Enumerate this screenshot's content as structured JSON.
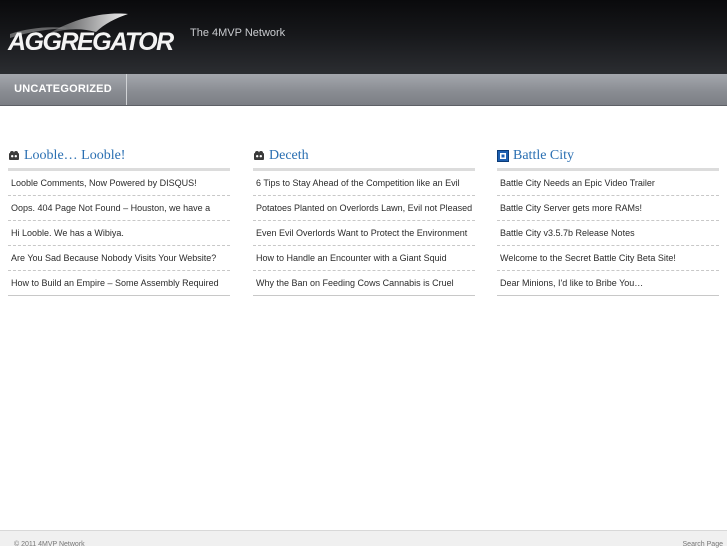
{
  "header": {
    "logo_text": "AGGREGATOR",
    "tagline": "The 4MVP Network"
  },
  "nav": {
    "items": [
      {
        "label": "UNCATEGORIZED"
      }
    ]
  },
  "columns": [
    {
      "title": "Looble… Looble!",
      "icon": "looble-favicon-icon",
      "posts": [
        "Looble Comments, Now Powered by DISQUS!",
        "Oops. 404 Page Not Found – Houston, we have a",
        "Hi Looble. We has a Wibiya.",
        "Are You Sad Because Nobody Visits Your Website?",
        "How to Build an Empire – Some Assembly Required"
      ]
    },
    {
      "title": "Deceth",
      "icon": "deceth-favicon-icon",
      "posts": [
        "6 Tips to Stay Ahead of the Competition like an Evil",
        "Potatoes Planted on Overlords Lawn, Evil not Pleased",
        "Even Evil Overlords Want to Protect the Environment",
        "How to Handle an Encounter with a Giant Squid",
        "Why the Ban on Feeding Cows Cannabis is Cruel"
      ]
    },
    {
      "title": "Battle City",
      "icon": "battle-city-favicon-icon",
      "posts": [
        "Battle City Needs an Epic Video Trailer",
        "Battle City Server gets more RAMs!",
        "Battle City v3.5.7b Release Notes",
        "Welcome to the Secret Battle City Beta Site!",
        "Dear Minions, I'd like to Bribe You…"
      ]
    }
  ],
  "footer": {
    "left": "© 2011 4MVP Network",
    "right": "Search Page"
  },
  "colors": {
    "link_blue": "#2a6fb2",
    "header_dark": "#16171a",
    "nav_gray": "#8a8d93"
  }
}
